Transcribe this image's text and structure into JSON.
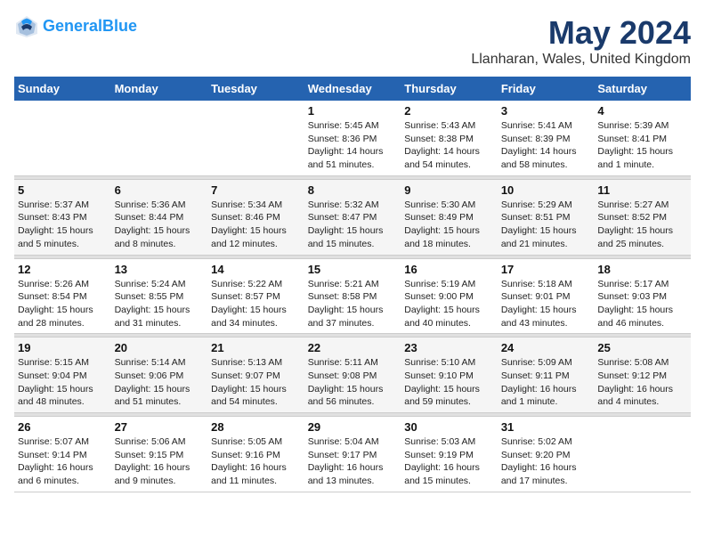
{
  "header": {
    "logo_line1": "General",
    "logo_line2": "Blue",
    "title": "May 2024",
    "subtitle": "Llanharan, Wales, United Kingdom"
  },
  "weekdays": [
    "Sunday",
    "Monday",
    "Tuesday",
    "Wednesday",
    "Thursday",
    "Friday",
    "Saturday"
  ],
  "weeks": [
    [
      {
        "day": "",
        "lines": []
      },
      {
        "day": "",
        "lines": []
      },
      {
        "day": "",
        "lines": []
      },
      {
        "day": "1",
        "lines": [
          "Sunrise: 5:45 AM",
          "Sunset: 8:36 PM",
          "Daylight: 14 hours",
          "and 51 minutes."
        ]
      },
      {
        "day": "2",
        "lines": [
          "Sunrise: 5:43 AM",
          "Sunset: 8:38 PM",
          "Daylight: 14 hours",
          "and 54 minutes."
        ]
      },
      {
        "day": "3",
        "lines": [
          "Sunrise: 5:41 AM",
          "Sunset: 8:39 PM",
          "Daylight: 14 hours",
          "and 58 minutes."
        ]
      },
      {
        "day": "4",
        "lines": [
          "Sunrise: 5:39 AM",
          "Sunset: 8:41 PM",
          "Daylight: 15 hours",
          "and 1 minute."
        ]
      }
    ],
    [
      {
        "day": "5",
        "lines": [
          "Sunrise: 5:37 AM",
          "Sunset: 8:43 PM",
          "Daylight: 15 hours",
          "and 5 minutes."
        ]
      },
      {
        "day": "6",
        "lines": [
          "Sunrise: 5:36 AM",
          "Sunset: 8:44 PM",
          "Daylight: 15 hours",
          "and 8 minutes."
        ]
      },
      {
        "day": "7",
        "lines": [
          "Sunrise: 5:34 AM",
          "Sunset: 8:46 PM",
          "Daylight: 15 hours",
          "and 12 minutes."
        ]
      },
      {
        "day": "8",
        "lines": [
          "Sunrise: 5:32 AM",
          "Sunset: 8:47 PM",
          "Daylight: 15 hours",
          "and 15 minutes."
        ]
      },
      {
        "day": "9",
        "lines": [
          "Sunrise: 5:30 AM",
          "Sunset: 8:49 PM",
          "Daylight: 15 hours",
          "and 18 minutes."
        ]
      },
      {
        "day": "10",
        "lines": [
          "Sunrise: 5:29 AM",
          "Sunset: 8:51 PM",
          "Daylight: 15 hours",
          "and 21 minutes."
        ]
      },
      {
        "day": "11",
        "lines": [
          "Sunrise: 5:27 AM",
          "Sunset: 8:52 PM",
          "Daylight: 15 hours",
          "and 25 minutes."
        ]
      }
    ],
    [
      {
        "day": "12",
        "lines": [
          "Sunrise: 5:26 AM",
          "Sunset: 8:54 PM",
          "Daylight: 15 hours",
          "and 28 minutes."
        ]
      },
      {
        "day": "13",
        "lines": [
          "Sunrise: 5:24 AM",
          "Sunset: 8:55 PM",
          "Daylight: 15 hours",
          "and 31 minutes."
        ]
      },
      {
        "day": "14",
        "lines": [
          "Sunrise: 5:22 AM",
          "Sunset: 8:57 PM",
          "Daylight: 15 hours",
          "and 34 minutes."
        ]
      },
      {
        "day": "15",
        "lines": [
          "Sunrise: 5:21 AM",
          "Sunset: 8:58 PM",
          "Daylight: 15 hours",
          "and 37 minutes."
        ]
      },
      {
        "day": "16",
        "lines": [
          "Sunrise: 5:19 AM",
          "Sunset: 9:00 PM",
          "Daylight: 15 hours",
          "and 40 minutes."
        ]
      },
      {
        "day": "17",
        "lines": [
          "Sunrise: 5:18 AM",
          "Sunset: 9:01 PM",
          "Daylight: 15 hours",
          "and 43 minutes."
        ]
      },
      {
        "day": "18",
        "lines": [
          "Sunrise: 5:17 AM",
          "Sunset: 9:03 PM",
          "Daylight: 15 hours",
          "and 46 minutes."
        ]
      }
    ],
    [
      {
        "day": "19",
        "lines": [
          "Sunrise: 5:15 AM",
          "Sunset: 9:04 PM",
          "Daylight: 15 hours",
          "and 48 minutes."
        ]
      },
      {
        "day": "20",
        "lines": [
          "Sunrise: 5:14 AM",
          "Sunset: 9:06 PM",
          "Daylight: 15 hours",
          "and 51 minutes."
        ]
      },
      {
        "day": "21",
        "lines": [
          "Sunrise: 5:13 AM",
          "Sunset: 9:07 PM",
          "Daylight: 15 hours",
          "and 54 minutes."
        ]
      },
      {
        "day": "22",
        "lines": [
          "Sunrise: 5:11 AM",
          "Sunset: 9:08 PM",
          "Daylight: 15 hours",
          "and 56 minutes."
        ]
      },
      {
        "day": "23",
        "lines": [
          "Sunrise: 5:10 AM",
          "Sunset: 9:10 PM",
          "Daylight: 15 hours",
          "and 59 minutes."
        ]
      },
      {
        "day": "24",
        "lines": [
          "Sunrise: 5:09 AM",
          "Sunset: 9:11 PM",
          "Daylight: 16 hours",
          "and 1 minute."
        ]
      },
      {
        "day": "25",
        "lines": [
          "Sunrise: 5:08 AM",
          "Sunset: 9:12 PM",
          "Daylight: 16 hours",
          "and 4 minutes."
        ]
      }
    ],
    [
      {
        "day": "26",
        "lines": [
          "Sunrise: 5:07 AM",
          "Sunset: 9:14 PM",
          "Daylight: 16 hours",
          "and 6 minutes."
        ]
      },
      {
        "day": "27",
        "lines": [
          "Sunrise: 5:06 AM",
          "Sunset: 9:15 PM",
          "Daylight: 16 hours",
          "and 9 minutes."
        ]
      },
      {
        "day": "28",
        "lines": [
          "Sunrise: 5:05 AM",
          "Sunset: 9:16 PM",
          "Daylight: 16 hours",
          "and 11 minutes."
        ]
      },
      {
        "day": "29",
        "lines": [
          "Sunrise: 5:04 AM",
          "Sunset: 9:17 PM",
          "Daylight: 16 hours",
          "and 13 minutes."
        ]
      },
      {
        "day": "30",
        "lines": [
          "Sunrise: 5:03 AM",
          "Sunset: 9:19 PM",
          "Daylight: 16 hours",
          "and 15 minutes."
        ]
      },
      {
        "day": "31",
        "lines": [
          "Sunrise: 5:02 AM",
          "Sunset: 9:20 PM",
          "Daylight: 16 hours",
          "and 17 minutes."
        ]
      },
      {
        "day": "",
        "lines": []
      }
    ]
  ]
}
